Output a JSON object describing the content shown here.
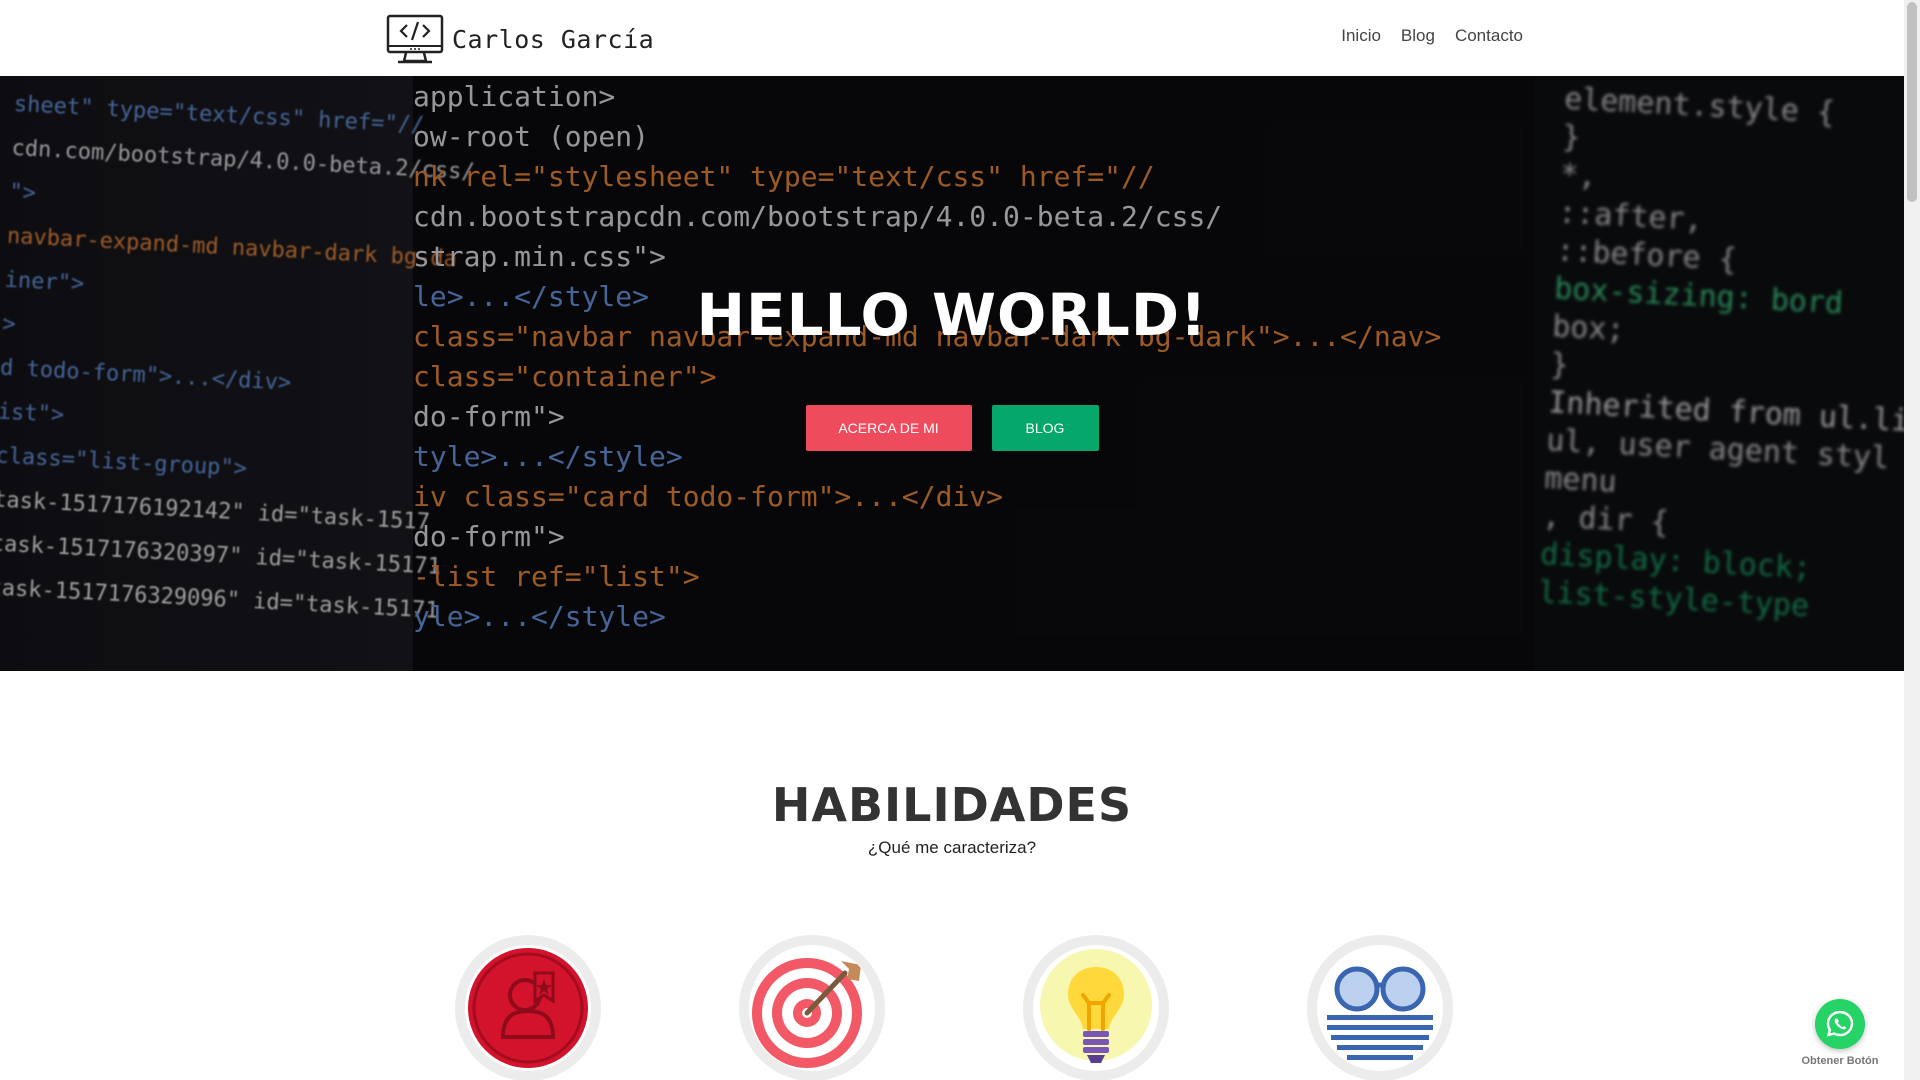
{
  "header": {
    "brand_name": "Carlos García",
    "logo_icon": "monitor-code-icon",
    "nav": [
      {
        "label": "Inicio"
      },
      {
        "label": "Blog"
      },
      {
        "label": "Contacto"
      }
    ]
  },
  "hero": {
    "title": "HELLO WORLD!",
    "buttons": {
      "about_label": "ACERCA DE MI",
      "blog_label": "BLOG"
    },
    "colors": {
      "about": "#ee4b5d",
      "blog": "#05a86a"
    },
    "code_lines": [
      "application>",
      "ow-root (open)",
      "nk rel=\"stylesheet\" type=\"text/css\" href=\"//",
      "cdn.bootstrapcdn.com/bootstrap/4.0.0-beta.2/css/",
      "strap.min.css\">",
      "le>...</style>",
      "class=\"navbar navbar-expand-md navbar-dark bg-dark\">...</nav>",
      "class=\"container\">",
      "do-form\">",
      "tyle>...</style>",
      "iv class=\"card todo-form\">...</div>",
      "do-form\">",
      "-list ref=\"list\">",
      "yle>...</style>"
    ],
    "code_left": [
      "sheet\" type=\"text/css\" href=\"//",
      "cdn.com/bootstrap/4.0.0-beta.2/css/",
      "\">",
      "navbar-expand-md navbar-dark bg-da",
      "iner\">",
      ">",
      "d todo-form\">...</div>",
      "ist\">",
      "class=\"list-group\">",
      "task-1517176192142\" id=\"task-1517",
      "task-1517176320397\" id=\"task-15171",
      "task-1517176329096\" id=\"task-15171"
    ],
    "code_right": [
      "element.style {",
      "}",
      "*,",
      "::after,",
      "::before {",
      "box-sizing: bord",
      "box;",
      "}",
      "Inherited from ul.list",
      "ul, user agent styl",
      "menu",
      ", dir {",
      "display: block;",
      "list-style-type"
    ]
  },
  "skills": {
    "title": "HABILIDADES",
    "subtitle": "¿Qué me caracteriza?",
    "icons": [
      {
        "name": "leader-badge-icon"
      },
      {
        "name": "target-dart-icon"
      },
      {
        "name": "lightbulb-icon"
      },
      {
        "name": "glasses-icon"
      }
    ]
  },
  "whatsapp": {
    "label": "Obtener Botón",
    "color": "#25d366"
  }
}
